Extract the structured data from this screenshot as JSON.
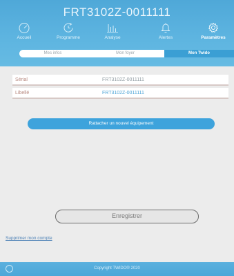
{
  "header": {
    "device_id": "FRT3102Z-0011111"
  },
  "nav": {
    "items": [
      {
        "label": "Accueil",
        "icon": "gauge-icon"
      },
      {
        "label": "Programme",
        "icon": "clock-cycle-icon"
      },
      {
        "label": "Analyse",
        "icon": "bar-chart-icon"
      },
      {
        "label": "Alertes",
        "icon": "bell-icon"
      },
      {
        "label": "Paramètres",
        "icon": "gear-icon"
      }
    ],
    "active": "Paramètres"
  },
  "subtabs": {
    "items": [
      "Mes infos",
      "Mon foyer",
      "Mon Twido"
    ],
    "active": "Mon Twido"
  },
  "form": {
    "serial_label": "Sérial",
    "serial_value": "FRT3102Z-0011111",
    "libelle_label": "Libellé",
    "libelle_value": "FRT3102Z-0011111"
  },
  "actions": {
    "attach_label": "Rattacher un nouvel équipement",
    "save_label": "Enregistrer",
    "delete_account_label": "Supprimer mon compte"
  },
  "footer": {
    "copyright": "Copyright TWIDO® 2020"
  },
  "colors": {
    "primary": "#3ea3dc",
    "header": "#5db4e0",
    "background": "#ececec"
  }
}
